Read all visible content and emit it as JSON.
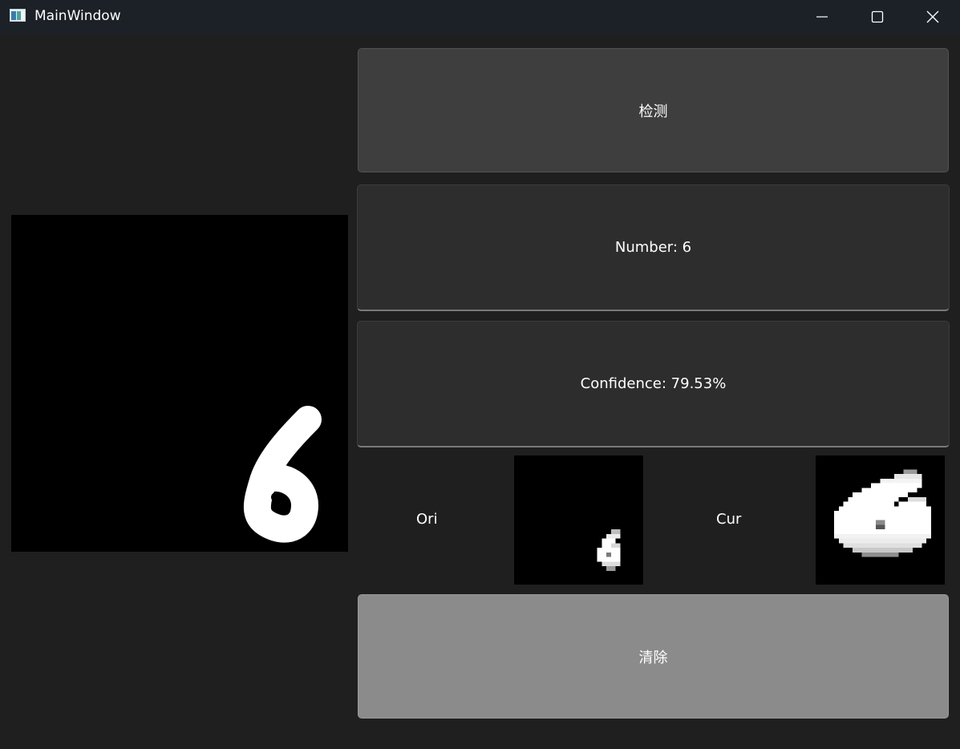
{
  "window": {
    "title": "MainWindow",
    "icon": "app-window-icon"
  },
  "controls": {
    "minimize_icon": "minimize-icon",
    "maximize_icon": "maximize-icon",
    "close_icon": "close-icon"
  },
  "buttons": {
    "detect_label": "检测",
    "clear_label": "清除"
  },
  "result": {
    "number_text": "Number: 6",
    "confidence_text": "Confidence: 79.53%"
  },
  "thumbnails": {
    "ori_label": "Ori",
    "cur_label": "Cur"
  },
  "colors": {
    "background": "#1f1f1f",
    "titlebar": "#1c2128",
    "detect_button": "#3e3e3e",
    "result_box": "#2d2d2d",
    "clear_button": "#8b8b8b",
    "canvas": "#000000",
    "stroke": "#ffffff"
  }
}
